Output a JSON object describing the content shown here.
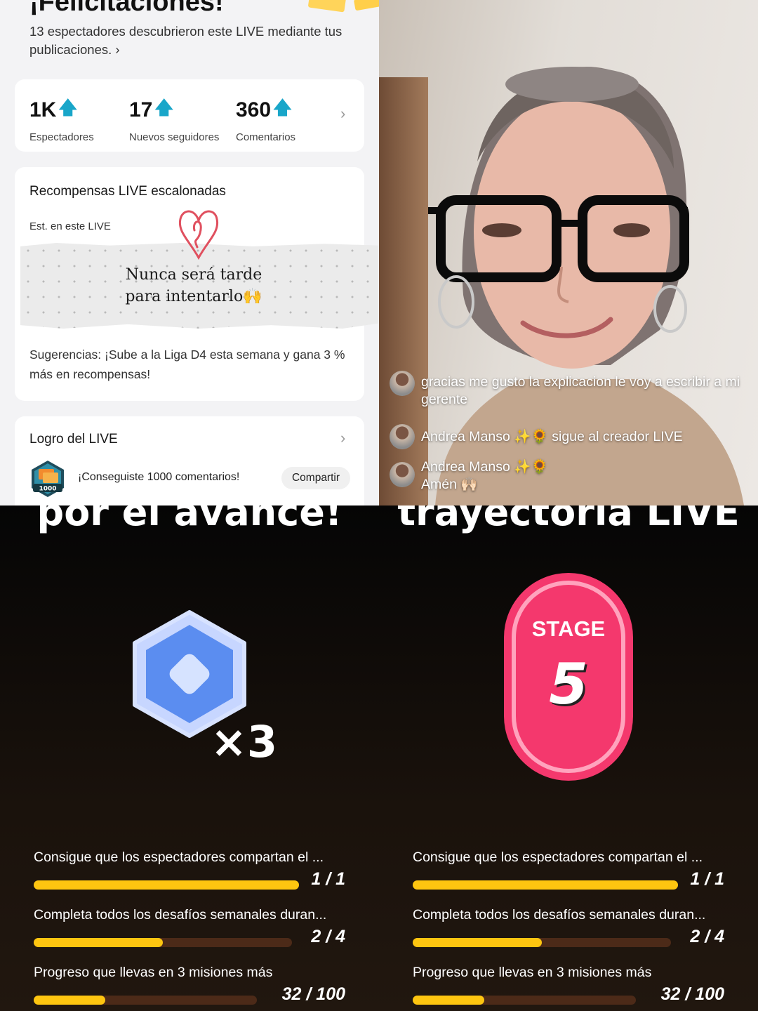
{
  "summary": {
    "title": "¡Felicitaciones!",
    "subtitle": "13 espectadores descubrieron este LIVE mediante tus publicaciones.",
    "subtitle_chevron": "›",
    "stats": [
      {
        "value": "1K",
        "label": "Espectadores"
      },
      {
        "value": "17",
        "label": "Nuevos seguidores"
      },
      {
        "value": "360",
        "label": "Comentarios"
      }
    ],
    "up_arrow": "🡅"
  },
  "rewards": {
    "title": "Recompensas LIVE escalonadas",
    "est_label": "Est. en este LIVE",
    "note_line1": "Nunca será tarde",
    "note_line2": "para intentarlo🙌",
    "suggestion": "Sugerencias: ¡Sube a la Liga D4 esta semana y gana 3 % más en recompensas!"
  },
  "achievement": {
    "title": "Logro del LIVE",
    "badge_text": "1000",
    "text": "¡Conseguiste 1000 comentarios!",
    "share_label": "Compartir"
  },
  "live": {
    "comments": [
      {
        "user": "",
        "text": "gracias me gusto la explicacion le voy a escribir a mi gerente"
      },
      {
        "user": "Andrea Manso ✨🌻",
        "text": "sigue al creador LIVE"
      },
      {
        "user": "Andrea Manso ✨🌻",
        "text": "Amén 🙌🏻"
      }
    ]
  },
  "progress_panel": {
    "heading": "por el avance!",
    "multiplier": "×3",
    "missions": [
      {
        "title": "Consigue que los espectadores compartan el ...",
        "count": "1 / 1",
        "progress": 1.0
      },
      {
        "title": "Completa todos los desafíos semanales duran...",
        "count": "2 / 4",
        "progress": 0.5
      },
      {
        "title": "Progreso que llevas en 3 misiones más",
        "count": "32 / 100",
        "progress": 0.32
      }
    ]
  },
  "stage_panel": {
    "heading": "trayectoria LIVE",
    "stage_label": "STAGE",
    "stage_number": "5",
    "missions": [
      {
        "title": "Consigue que los espectadores compartan el ...",
        "count": "1 / 1",
        "progress": 1.0
      },
      {
        "title": "Completa todos los desafíos semanales duran...",
        "count": "2 / 4",
        "progress": 0.5
      },
      {
        "title": "Progreso que llevas en 3 misiones más",
        "count": "32 / 100",
        "progress": 0.32
      }
    ]
  },
  "colors": {
    "accent_arrow": "#19a6c9",
    "progress_fill": "#fdc510",
    "progress_track": "#4c2a18",
    "stage_pink": "#f4386d",
    "hex_blue": "#5b8df0"
  }
}
